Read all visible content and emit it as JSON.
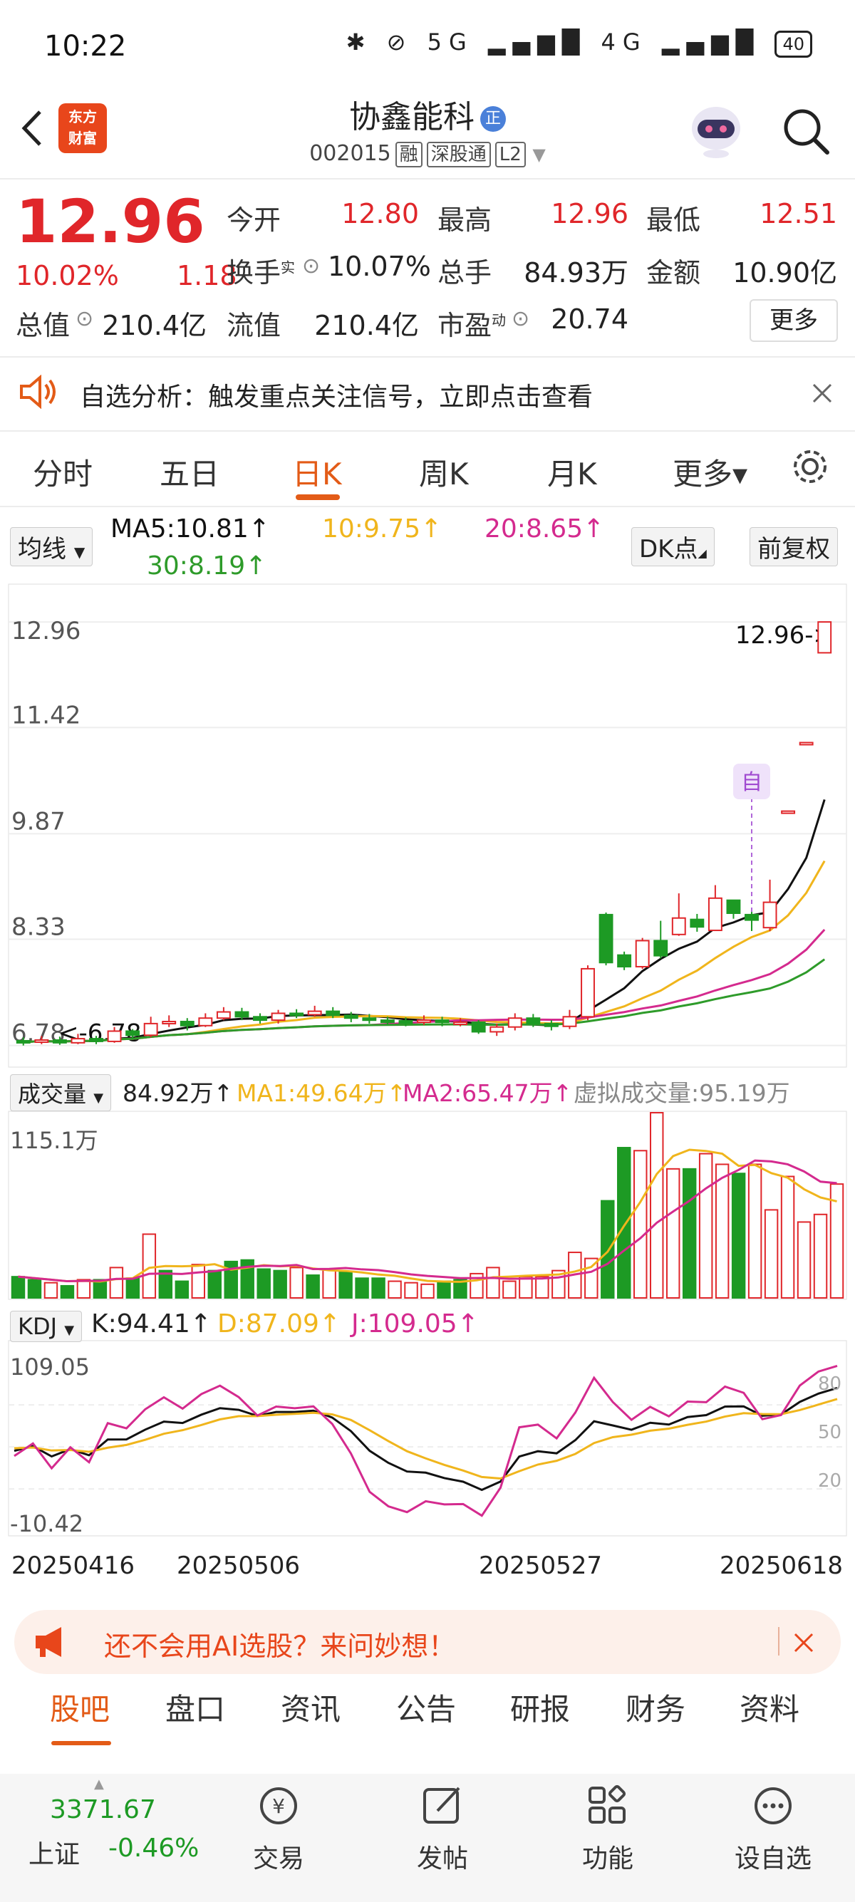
{
  "status": {
    "time": "10:22",
    "icons": "✱ ⊘ 5G ▂▄▆█ 4G ▂▄▆█",
    "battery": "40"
  },
  "header": {
    "logo_line1": "东方",
    "logo_line2": "财富",
    "title": "协鑫能科",
    "verify": "正",
    "code": "002015",
    "tag1": "融",
    "tag2": "深股通",
    "tag3": "L2"
  },
  "quote": {
    "price": "12.96",
    "change_pct": "10.02%",
    "change": "1.18",
    "open_label": "今开",
    "open": "12.80",
    "high_label": "最高",
    "high": "12.96",
    "low_label": "最低",
    "low": "12.51",
    "turnover_label": "换手",
    "turnover_sup": "实",
    "turnover": "10.07%",
    "volume_label": "总手",
    "volume": "84.93万",
    "amount_label": "金额",
    "amount": "10.90亿",
    "mcap_label": "总值",
    "mcap": "210.4亿",
    "float_label": "流值",
    "float": "210.4亿",
    "pe_label": "市盈",
    "pe_sup": "动",
    "pe": "20.74",
    "more": "更多"
  },
  "alert": {
    "text": "自选分析：触发重点关注信号，立即点击查看"
  },
  "ktabs": [
    "分时",
    "五日",
    "日K",
    "周K",
    "月K",
    "更多▾"
  ],
  "ma": {
    "select": "均线",
    "ma5": "MA5:10.81↑",
    "ma10": "10:9.75↑",
    "ma20": "20:8.65↑",
    "ma30": "30:8.19↑",
    "dk": "DK点",
    "fq": "前复权"
  },
  "colors": {
    "up": "#e0262a",
    "down": "#1d9a24",
    "ma5": "#111111",
    "ma10": "#f0b51c",
    "ma20": "#d42a8e",
    "ma30": "#2e9b2a",
    "accent": "#e35b17"
  },
  "chart_data": [
    {
      "type": "candlestick",
      "y_ticks": [
        "12.96",
        "11.42",
        "9.87",
        "8.33",
        "6.78"
      ],
      "ylim": [
        6.78,
        12.96
      ],
      "last_label": "12.96->",
      "low_label": "<-6.78",
      "marker": "自",
      "x": [
        "20250416",
        "",
        "",
        "",
        "",
        "",
        "",
        "",
        "",
        "",
        "",
        "",
        "",
        "",
        "",
        "20250506",
        "",
        "",
        "",
        "",
        "",
        "",
        "",
        "",
        "",
        "",
        "",
        "",
        "",
        "20250527",
        "",
        "",
        "",
        "",
        "",
        "",
        "",
        "",
        "",
        "",
        "",
        "",
        "",
        "",
        "",
        "",
        "",
        "",
        "",
        "20250618"
      ],
      "candles": [
        [
          6.85,
          6.83,
          6.9,
          6.78
        ],
        [
          6.84,
          6.86,
          6.92,
          6.8
        ],
        [
          6.86,
          6.82,
          6.91,
          6.79
        ],
        [
          6.82,
          6.88,
          6.95,
          6.8
        ],
        [
          6.88,
          6.84,
          6.92,
          6.8
        ],
        [
          6.84,
          6.99,
          7.05,
          6.82
        ],
        [
          6.99,
          6.93,
          7.02,
          6.88
        ],
        [
          6.93,
          7.1,
          7.2,
          6.9
        ],
        [
          7.1,
          7.13,
          7.22,
          7.05
        ],
        [
          7.13,
          7.07,
          7.18,
          7.0
        ],
        [
          7.07,
          7.18,
          7.25,
          7.05
        ],
        [
          7.18,
          7.27,
          7.34,
          7.15
        ],
        [
          7.27,
          7.2,
          7.33,
          7.15
        ],
        [
          7.2,
          7.15,
          7.25,
          7.1
        ],
        [
          7.15,
          7.25,
          7.3,
          7.1
        ],
        [
          7.25,
          7.23,
          7.31,
          7.18
        ],
        [
          7.23,
          7.28,
          7.36,
          7.2
        ],
        [
          7.28,
          7.22,
          7.34,
          7.18
        ],
        [
          7.22,
          7.18,
          7.27,
          7.12
        ],
        [
          7.18,
          7.15,
          7.24,
          7.1
        ],
        [
          7.15,
          7.14,
          7.2,
          7.08
        ],
        [
          7.14,
          7.12,
          7.19,
          7.06
        ],
        [
          7.12,
          7.15,
          7.22,
          7.08
        ],
        [
          7.15,
          7.12,
          7.2,
          7.06
        ],
        [
          7.12,
          7.12,
          7.18,
          7.06
        ],
        [
          7.12,
          6.98,
          7.15,
          6.95
        ],
        [
          6.98,
          7.05,
          7.1,
          6.92
        ],
        [
          7.05,
          7.18,
          7.25,
          7.0
        ],
        [
          7.18,
          7.1,
          7.24,
          7.05
        ],
        [
          7.1,
          7.06,
          7.15,
          7.0
        ],
        [
          7.06,
          7.2,
          7.3,
          7.02
        ],
        [
          7.2,
          7.9,
          7.95,
          7.15
        ],
        [
          8.69,
          7.99,
          8.72,
          7.95
        ],
        [
          8.1,
          7.93,
          8.15,
          7.88
        ],
        [
          7.93,
          8.31,
          8.35,
          7.9
        ],
        [
          8.31,
          8.09,
          8.6,
          8.05
        ],
        [
          8.4,
          8.64,
          9.0,
          8.38
        ],
        [
          8.62,
          8.51,
          8.7,
          8.44
        ],
        [
          8.46,
          8.93,
          9.12,
          8.46
        ],
        [
          8.9,
          8.71,
          8.85,
          8.63
        ],
        [
          8.69,
          8.61,
          8.73,
          8.45
        ],
        [
          8.5,
          8.87,
          9.2,
          8.45
        ],
        [
          10.2,
          10.2,
          10.2,
          10.2
        ],
        [
          11.2,
          11.2,
          11.2,
          11.2
        ],
        [
          12.51,
          12.96,
          12.96,
          12.51
        ]
      ],
      "ma_lines": [
        "MA5",
        "MA10",
        "MA20",
        "MA30"
      ]
    },
    {
      "type": "bar",
      "title": "成交量",
      "legend": {
        "select": "成交量",
        "v": "84.92万↑",
        "ma1": "MA1:49.64万↑",
        "ma2": "MA2:65.47万↑",
        "virtual": "虚拟成交量:95.19万"
      },
      "y_top": "115.1万",
      "values": [
        14,
        12,
        10,
        8,
        12,
        12,
        20,
        13,
        42,
        18,
        11,
        22,
        18,
        24,
        25,
        19,
        18,
        20,
        15,
        19,
        17,
        13,
        13,
        11,
        10,
        9,
        11,
        12,
        16,
        20,
        11,
        14,
        14,
        18,
        30,
        26,
        64,
        99,
        97,
        122,
        85,
        85,
        95,
        88,
        82,
        88,
        58,
        80,
        50,
        55,
        75
      ],
      "up": [
        0,
        0,
        1,
        0,
        1,
        0,
        1,
        0,
        1,
        0,
        0,
        1,
        0,
        0,
        0,
        0,
        0,
        1,
        0,
        1,
        0,
        0,
        0,
        1,
        1,
        1,
        0,
        0,
        1,
        1,
        1,
        1,
        1,
        1,
        1,
        1,
        0,
        0,
        1,
        1,
        1,
        0,
        1,
        1,
        0,
        1,
        1,
        1,
        1,
        1,
        1
      ]
    },
    {
      "type": "line",
      "title": "KDJ",
      "legend": {
        "select": "KDJ",
        "k": "K:94.41↑",
        "d": "D:87.09↑",
        "j": "J:109.05↑"
      },
      "y_labels_left": [
        "109.05",
        "-10.42"
      ],
      "y_labels_right": [
        "80",
        "50",
        "20"
      ],
      "ylim": [
        -10.42,
        109.05
      ],
      "x_labels": [
        "20250416",
        "20250506",
        "20250527",
        "20250618"
      ]
    }
  ],
  "vol_top_label": "115.1万",
  "banner": {
    "text": "还不会用AI选股？来问妙想！"
  },
  "bottom_tabs": [
    "股吧",
    "盘口",
    "资讯",
    "公告",
    "研报",
    "财务",
    "资料"
  ],
  "nav": {
    "index_value": "3371.67",
    "index_name": "上证",
    "index_change": "-0.46%",
    "items": [
      "交易",
      "发帖",
      "功能",
      "设自选"
    ]
  }
}
